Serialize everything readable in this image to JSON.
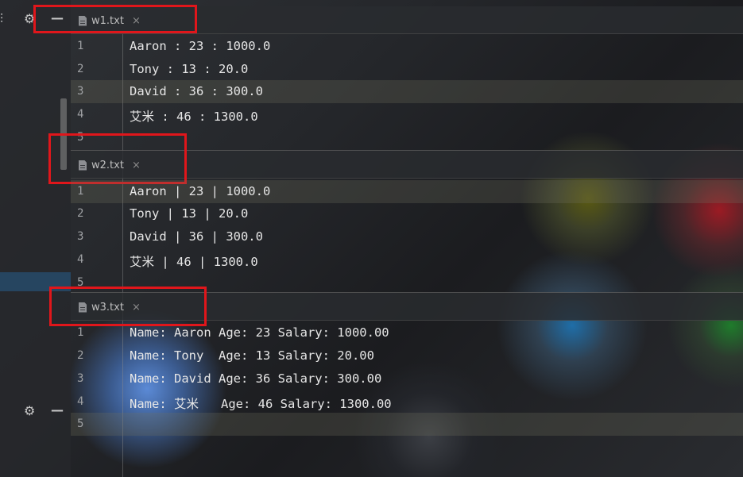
{
  "panes": [
    {
      "tab": {
        "filename": "w1.txt",
        "close": "×"
      },
      "lines": [
        {
          "num": "1",
          "text": "Aaron : 23 : 1000.0"
        },
        {
          "num": "2",
          "text": "Tony : 13 : 20.0"
        },
        {
          "num": "3",
          "text": "David : 36 : 300.0"
        },
        {
          "num": "4",
          "text": "艾米 : 46 : 1300.0"
        },
        {
          "num": "5",
          "text": ""
        }
      ]
    },
    {
      "tab": {
        "filename": "w2.txt",
        "close": "×"
      },
      "lines": [
        {
          "num": "1",
          "text": "Aaron | 23 | 1000.0"
        },
        {
          "num": "2",
          "text": "Tony | 13 | 20.0"
        },
        {
          "num": "3",
          "text": "David | 36 | 300.0"
        },
        {
          "num": "4",
          "text": "艾米 | 46 | 1300.0"
        },
        {
          "num": "5",
          "text": ""
        }
      ]
    },
    {
      "tab": {
        "filename": "w3.txt",
        "close": "×"
      },
      "lines": [
        {
          "num": "1",
          "text": "Name: Aaron Age: 23 Salary: 1000.00"
        },
        {
          "num": "2",
          "text": "Name: Tony  Age: 13 Salary: 20.00"
        },
        {
          "num": "3",
          "text": "Name: David Age: 36 Salary: 300.00"
        },
        {
          "num": "4",
          "text": "Name: 艾米   Age: 46 Salary: 1300.00"
        },
        {
          "num": "5",
          "text": ""
        }
      ]
    }
  ],
  "icons": {
    "settings": "gear-icon",
    "minimize": "minimize-icon",
    "file": "file-icon",
    "close": "close-icon"
  },
  "colors": {
    "highlight_box": "#e0161b",
    "sidebar_selection": "#265c8c"
  }
}
